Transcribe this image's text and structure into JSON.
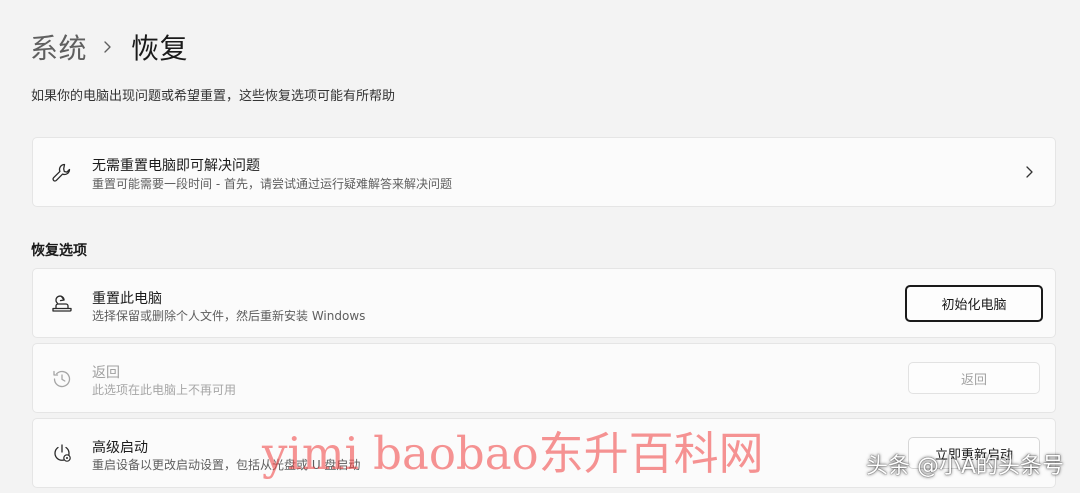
{
  "breadcrumb": {
    "parent": "系统",
    "current": "恢复"
  },
  "page_description": "如果你的电脑出现问题或希望重置，这些恢复选项可能有所帮助",
  "troubleshoot_card": {
    "title": "无需重置电脑即可解决问题",
    "subtitle": "重置可能需要一段时间 - 首先，请尝试通过运行疑难解答来解决问题",
    "icon": "wrench-icon"
  },
  "section_title": "恢复选项",
  "recovery_options": [
    {
      "title": "重置此电脑",
      "subtitle": "选择保留或删除个人文件，然后重新安装 Windows",
      "button": "初始化电脑",
      "icon": "reset-pc-icon",
      "enabled": true
    },
    {
      "title": "返回",
      "subtitle": "此选项在此电脑上不再可用",
      "button": "返回",
      "icon": "history-icon",
      "enabled": false
    },
    {
      "title": "高级启动",
      "subtitle": "重启设备以更改启动设置，包括从光盘或 U 盘启动",
      "button": "立即重新启动",
      "icon": "power-gear-icon",
      "enabled": true
    }
  ],
  "overlay": {
    "watermark": "yimi baobao东升百科网",
    "source_credit": "头条 @小A的头条号"
  },
  "colors": {
    "background": "#f3f3f3",
    "card": "#fbfbfb",
    "watermark": "#f03c3c"
  }
}
